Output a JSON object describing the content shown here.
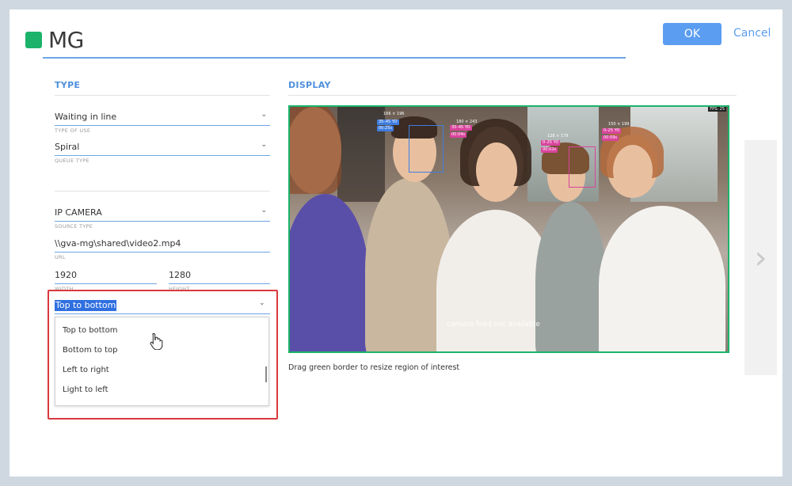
{
  "header": {
    "title": "MG",
    "ok_label": "OK",
    "cancel_label": "Cancel",
    "accent": "#1bb36b"
  },
  "sections": {
    "type": "TYPE",
    "display": "DISPLAY"
  },
  "fields": {
    "type_of_use": {
      "value": "Waiting in line",
      "label": "TYPE OF USE"
    },
    "queue_type": {
      "value": "Spiral",
      "label": "QUEUE TYPE"
    },
    "source_type": {
      "value": "IP CAMERA",
      "label": "SOURCE TYPE"
    },
    "url": {
      "value": "\\\\gva-mg\\shared\\video2.mp4",
      "label": "URL"
    },
    "width": {
      "value": "1920",
      "label": "WIDTH"
    },
    "height": {
      "value": "1280",
      "label": "HEIGHT"
    }
  },
  "direction_select": {
    "selected": "Top to bottom",
    "options": [
      "Top to bottom",
      "Bottom to top",
      "Left to right",
      "Light to left"
    ]
  },
  "display": {
    "hint": "Drag green border to resize region of interest",
    "overlay_note": "camera feed not available",
    "fps": "FPS: 25",
    "detections": [
      {
        "dims": "166 × 196",
        "age": "35–45 YO",
        "time": "00:25s",
        "color": "blue"
      },
      {
        "dims": "180 × 243",
        "age": "35–45 YO",
        "time": "00:04s",
        "color": "pink"
      },
      {
        "dims": "128 × 179",
        "age": "0–25 YO",
        "time": "00:02s",
        "color": "pink"
      },
      {
        "dims": "150 × 199",
        "age": "0–25 YO",
        "time": "00:09s",
        "color": "pink"
      }
    ]
  }
}
